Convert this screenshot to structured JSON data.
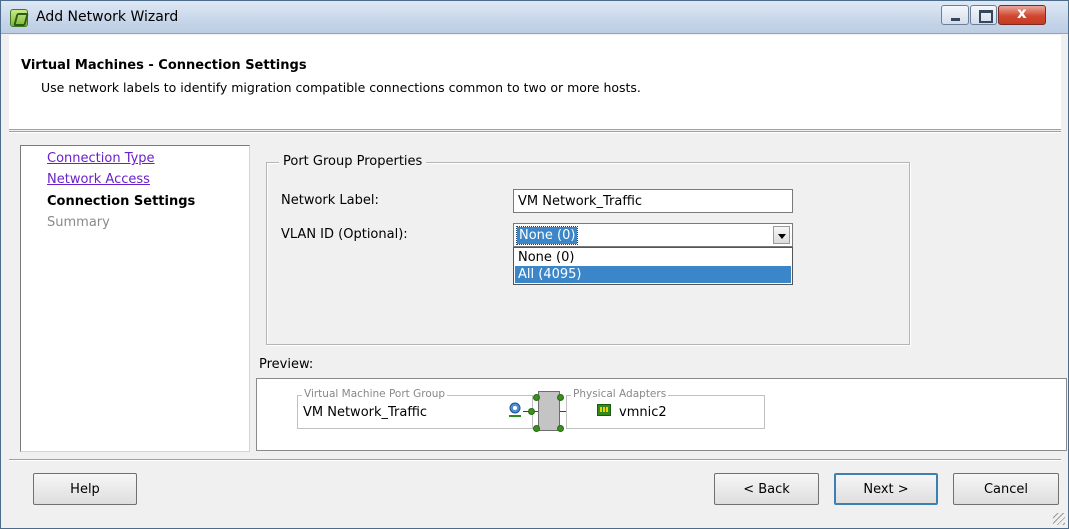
{
  "window": {
    "title": "Add Network Wizard"
  },
  "header": {
    "title": "Virtual Machines - Connection Settings",
    "description": "Use network labels to identify migration compatible connections common to two or more hosts."
  },
  "nav": {
    "items": [
      {
        "label": "Connection Type",
        "state": "link"
      },
      {
        "label": "Network Access",
        "state": "link"
      },
      {
        "label": "Connection Settings",
        "state": "current"
      },
      {
        "label": "Summary",
        "state": "future"
      }
    ]
  },
  "port_group": {
    "legend": "Port Group Properties",
    "network_label": {
      "label": "Network Label:",
      "value": "VM Network_Traffic"
    },
    "vlan": {
      "label": "VLAN ID (Optional):",
      "selected": "None (0)",
      "options": [
        "None (0)",
        "All (4095)"
      ],
      "highlighted_option": "All (4095)"
    }
  },
  "preview": {
    "label": "Preview:",
    "vm_port_group": {
      "legend": "Virtual Machine Port Group",
      "value": "VM Network_Traffic"
    },
    "physical_adapters": {
      "legend": "Physical Adapters",
      "value": "vmnic2"
    }
  },
  "footer": {
    "help_label": "Help",
    "back_label": "< Back",
    "next_label": "Next >",
    "cancel_label": "Cancel"
  },
  "colors": {
    "link": "#6a21c9",
    "selection": "#3a86c8",
    "close_button": "#d1472f"
  }
}
